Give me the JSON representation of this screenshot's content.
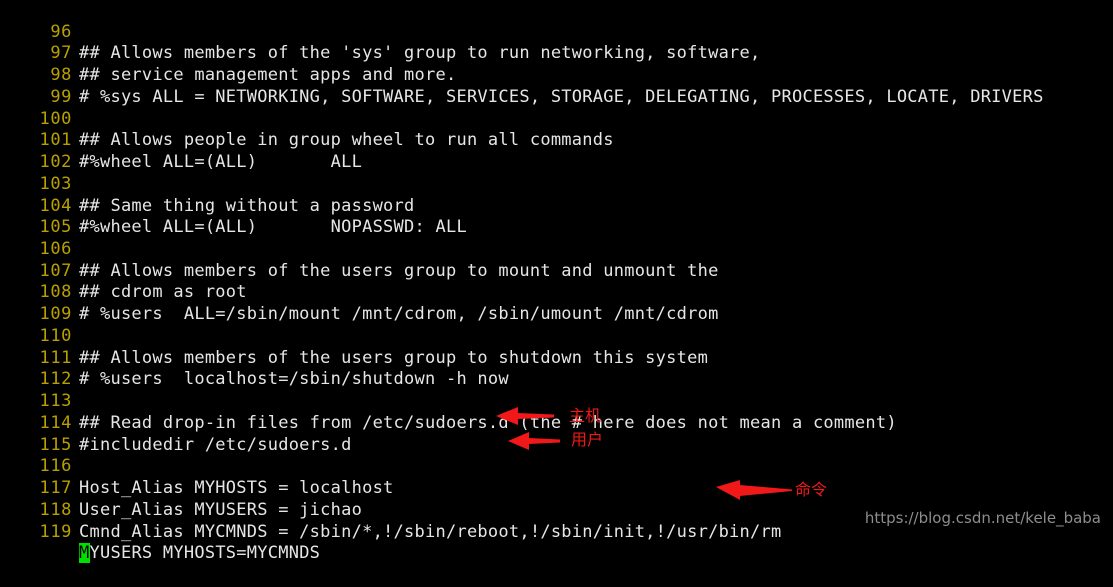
{
  "editor": {
    "background_color": "#000000",
    "lineno_color": "#b8a000",
    "code_color": "#e6e6e6",
    "cursor_color": "#00e000",
    "first_line_number": 96,
    "lines": [
      {
        "no": "96",
        "code": "## Allows members of the 'sys' group to run networking, software,"
      },
      {
        "no": "97",
        "code": "## service management apps and more."
      },
      {
        "no": "98",
        "code": "# %sys ALL = NETWORKING, SOFTWARE, SERVICES, STORAGE, DELEGATING, PROCESSES, LOCATE, DRIVERS"
      },
      {
        "no": "99",
        "code": ""
      },
      {
        "no": "100",
        "code": "## Allows people in group wheel to run all commands"
      },
      {
        "no": "101",
        "code": "#%wheel ALL=(ALL)       ALL"
      },
      {
        "no": "102",
        "code": ""
      },
      {
        "no": "103",
        "code": "## Same thing without a password"
      },
      {
        "no": "104",
        "code": "#%wheel ALL=(ALL)       NOPASSWD: ALL"
      },
      {
        "no": "105",
        "code": ""
      },
      {
        "no": "106",
        "code": "## Allows members of the users group to mount and unmount the"
      },
      {
        "no": "107",
        "code": "## cdrom as root"
      },
      {
        "no": "108",
        "code": "# %users  ALL=/sbin/mount /mnt/cdrom, /sbin/umount /mnt/cdrom"
      },
      {
        "no": "109",
        "code": ""
      },
      {
        "no": "110",
        "code": "## Allows members of the users group to shutdown this system"
      },
      {
        "no": "111",
        "code": "# %users  localhost=/sbin/shutdown -h now"
      },
      {
        "no": "112",
        "code": ""
      },
      {
        "no": "113",
        "code": "## Read drop-in files from /etc/sudoers.d (the # here does not mean a comment)"
      },
      {
        "no": "114",
        "code": "#includedir /etc/sudoers.d"
      },
      {
        "no": "115",
        "code": ""
      },
      {
        "no": "116",
        "code": "Host_Alias MYHOSTS = localhost"
      },
      {
        "no": "117",
        "code": "User_Alias MYUSERS = jichao"
      },
      {
        "no": "118",
        "code": "Cmnd_Alias MYCMNDS = /sbin/*,!/sbin/reboot,!/sbin/init,!/usr/bin/rm"
      },
      {
        "no": "119",
        "code": "",
        "cursor_char": "M",
        "code_after_cursor": "YUSERS MYHOSTS=MYCMNDS"
      }
    ]
  },
  "annotations": {
    "color": "#f01818",
    "items": [
      {
        "label": "主机",
        "arrow": "left-arrow-icon"
      },
      {
        "label": "用户",
        "arrow": "left-arrow-icon"
      },
      {
        "label": "命令",
        "arrow": "left-arrow-icon"
      }
    ]
  },
  "watermark": {
    "text": "https://blog.csdn.net/kele_baba",
    "color": "#8d8d8d"
  }
}
